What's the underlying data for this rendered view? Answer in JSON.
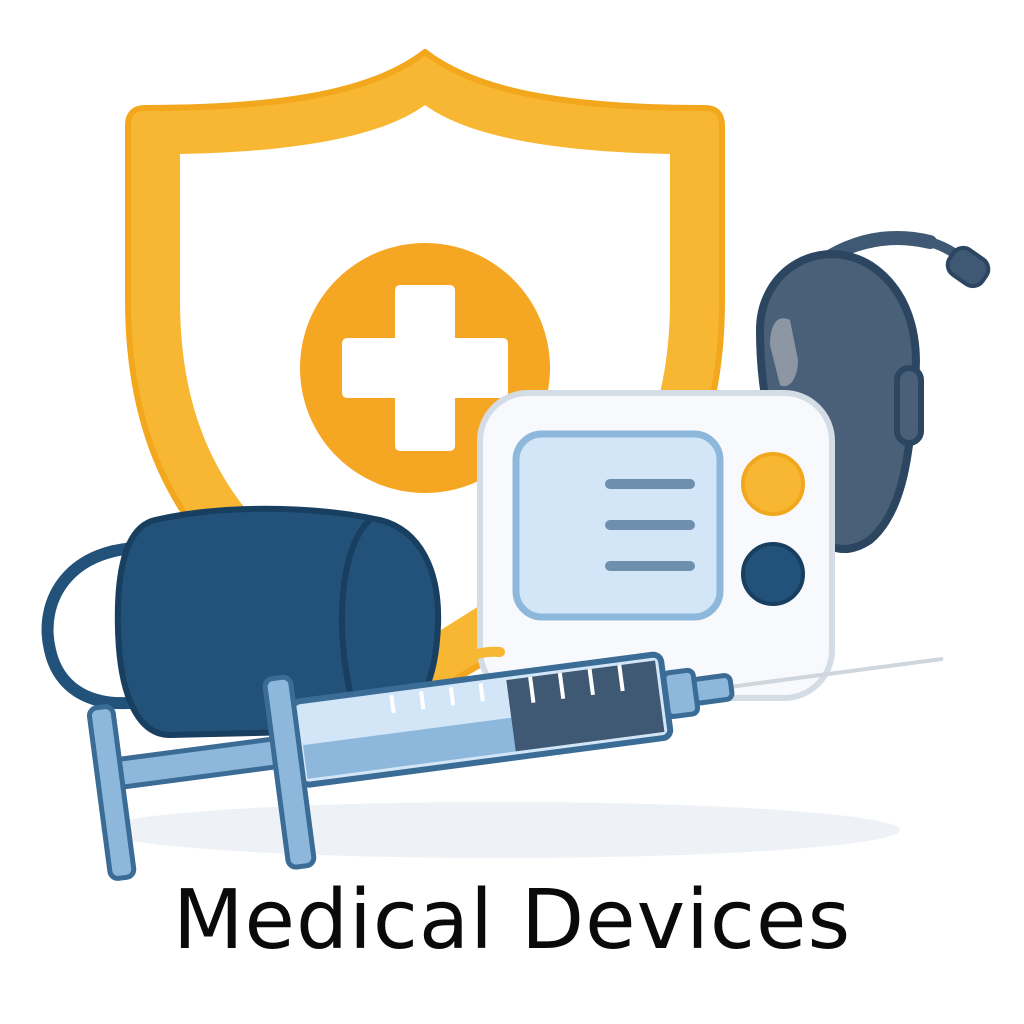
{
  "caption": "Medical Devices",
  "colors": {
    "shield_outer": "#F8B733",
    "shield_inner": "#FBC85A",
    "cross_circle": "#F5A623",
    "navy": "#22517A",
    "slate": "#3F5873",
    "light_blue": "#8DB8DC",
    "pale_blue": "#D3E6F8",
    "monitor_body": "#F7F9FC"
  },
  "icons": [
    "shield-cross-icon",
    "blood-pressure-cuff-icon",
    "blood-pressure-monitor-icon",
    "hearing-aid-icon",
    "syringe-icon"
  ]
}
